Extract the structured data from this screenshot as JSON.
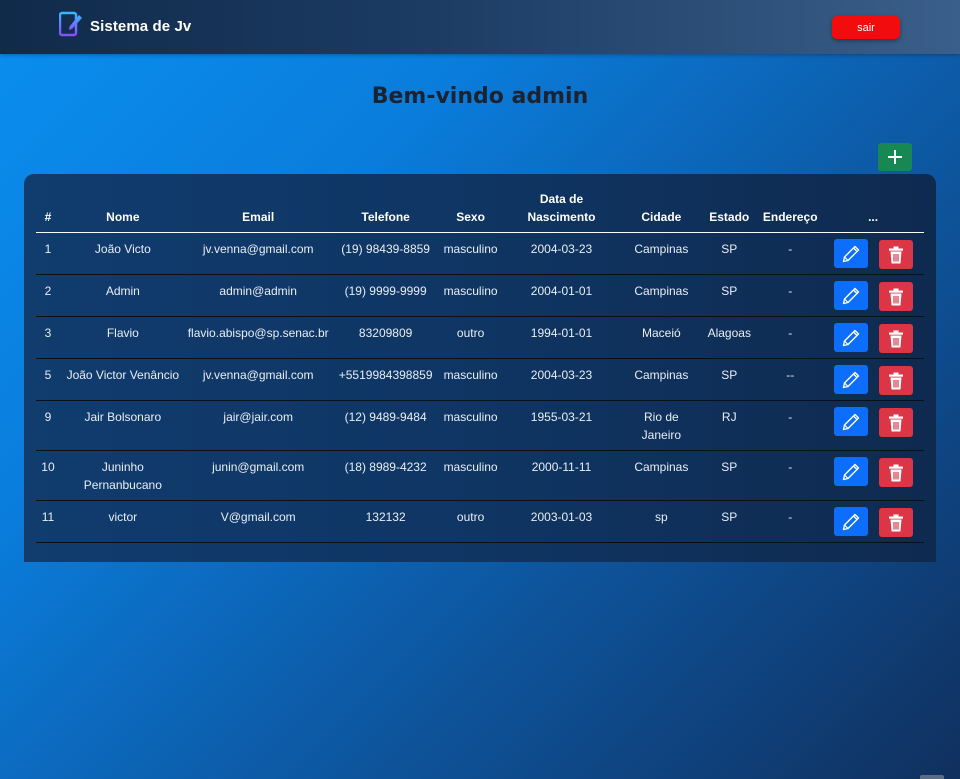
{
  "navbar": {
    "brand": "Sistema de Jv",
    "logout_label": "sair"
  },
  "welcome": {
    "prefix": "Bem-vindo ",
    "user": "admin"
  },
  "table": {
    "headers": [
      "#",
      "Nome",
      "Email",
      "Telefone",
      "Sexo",
      "Data de Nascimento",
      "Cidade",
      "Estado",
      "Endereço",
      "..."
    ],
    "rows": [
      {
        "id": "1",
        "nome": "João Victo",
        "email": "jv.venna@gmail.com",
        "telefone": "(19) 98439-8859",
        "sexo": "masculino",
        "nascimento": "2004-03-23",
        "cidade": "Campinas",
        "estado": "SP",
        "endereco": "-"
      },
      {
        "id": "2",
        "nome": "Admin",
        "email": "admin@admin",
        "telefone": "(19) 9999-9999",
        "sexo": "masculino",
        "nascimento": "2004-01-01",
        "cidade": "Campinas",
        "estado": "SP",
        "endereco": "-"
      },
      {
        "id": "3",
        "nome": "Flavio",
        "email": "flavio.abispo@sp.senac.br",
        "telefone": "83209809",
        "sexo": "outro",
        "nascimento": "1994-01-01",
        "cidade": "Maceió",
        "estado": "Alagoas",
        "endereco": "-"
      },
      {
        "id": "5",
        "nome": "João Victor Venâncio",
        "email": "jv.venna@gmail.com",
        "telefone": "+5519984398859",
        "sexo": "masculino",
        "nascimento": "2004-03-23",
        "cidade": "Campinas",
        "estado": "SP",
        "endereco": "--"
      },
      {
        "id": "9",
        "nome": "Jair Bolsonaro",
        "email": "jair@jair.com",
        "telefone": "(12) 9489-9484",
        "sexo": "masculino",
        "nascimento": "1955-03-21",
        "cidade": "Rio de Janeiro",
        "estado": "RJ",
        "endereco": "-"
      },
      {
        "id": "10",
        "nome": "Juninho Pernanbucano",
        "email": "junin@gmail.com",
        "telefone": "(18) 8989-4232",
        "sexo": "masculino",
        "nascimento": "2000-11-11",
        "cidade": "Campinas",
        "estado": "SP",
        "endereco": "-"
      },
      {
        "id": "11",
        "nome": "victor",
        "email": "V@gmail.com",
        "telefone": "132132",
        "sexo": "outro",
        "nascimento": "2003-01-03",
        "cidade": "sp",
        "estado": "SP",
        "endereco": "-"
      }
    ]
  },
  "icons": {
    "brand": "notebook-pen-icon",
    "add": "plus-icon",
    "edit": "pencil-icon",
    "delete": "trash-icon"
  },
  "colors": {
    "logout": "#f20c0c",
    "add": "#198754",
    "edit": "#0d6efd",
    "delete": "#dc3545"
  }
}
